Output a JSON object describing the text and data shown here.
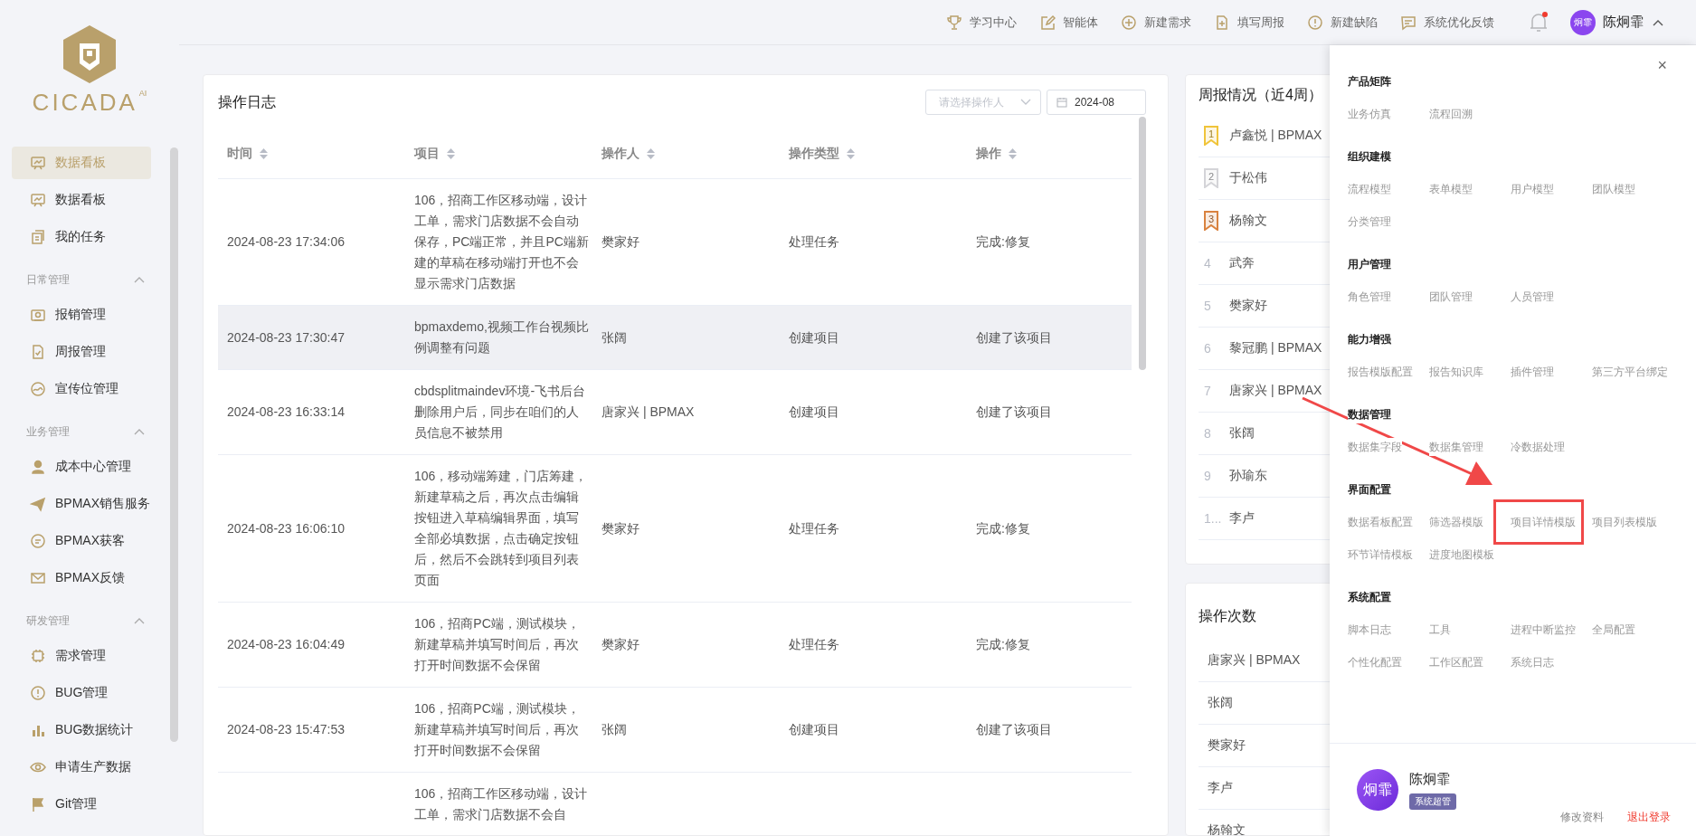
{
  "sidebar": {
    "logo": {
      "text": "CICADA",
      "badge": "AI"
    },
    "top_items": [
      {
        "label": "数据看板",
        "selected": true
      },
      {
        "label": "数据看板",
        "selected": false
      },
      {
        "label": "我的任务",
        "selected": false
      }
    ],
    "groups": [
      {
        "title": "日常管理",
        "expanded": true,
        "items": [
          {
            "label": "报销管理",
            "selected": false
          },
          {
            "label": "周报管理",
            "selected": false
          },
          {
            "label": "宣传位管理",
            "selected": false
          }
        ]
      },
      {
        "title": "业务管理",
        "expanded": true,
        "items": [
          {
            "label": "成本中心管理",
            "selected": false
          },
          {
            "label": "BPMAX销售服务",
            "selected": false
          },
          {
            "label": "BPMAX获客",
            "selected": false
          },
          {
            "label": "BPMAX反馈",
            "selected": false
          }
        ]
      },
      {
        "title": "研发管理",
        "expanded": true,
        "items": [
          {
            "label": "需求管理",
            "selected": false
          },
          {
            "label": "BUG管理",
            "selected": false
          },
          {
            "label": "BUG数据统计",
            "selected": false
          },
          {
            "label": "申请生产数据",
            "selected": false
          },
          {
            "label": "Git管理",
            "selected": false
          }
        ]
      }
    ]
  },
  "topbar": {
    "actions": [
      "学习中心",
      "智能体",
      "新建需求",
      "填写周报",
      "新建缺陷",
      "系统优化反馈"
    ],
    "notifications": {
      "unread": true
    },
    "user": {
      "avatar": "炯霏",
      "name": "陈炯霏",
      "menu_open": true
    }
  },
  "log_card": {
    "title": "操作日志",
    "operator_select": {
      "placeholder": "请选择操作人"
    },
    "month_picker": {
      "value": "2024-08"
    },
    "table": {
      "columns": [
        "时间",
        "项目",
        "操作人",
        "操作类型",
        "操作"
      ],
      "rows": [
        {
          "cells": [
            "2024-08-23 17:34:06",
            "106，招商工作区移动端，设计工单，需求门店数据不会自动保存，PC端正常，并且PC端新建的草稿在移动端打开也不会显示需求门店数据",
            "樊家好",
            "处理任务",
            "完成:修复"
          ],
          "hovered": false
        },
        {
          "cells": [
            "2024-08-23 17:30:47",
            "bpmaxdemo,视频工作台视频比例调整有问题",
            "张阔",
            "创建项目",
            "创建了该项目"
          ],
          "hovered": true
        },
        {
          "cells": [
            "2024-08-23 16:33:14",
            "cbdsplitmaindev环境-飞书后台删除用户后，同步在咱们的人员信息不被禁用",
            "唐家兴 | BPMAX",
            "创建项目",
            "创建了该项目"
          ],
          "hovered": false
        },
        {
          "cells": [
            "2024-08-23 16:06:10",
            "106，移动端筹建，门店筹建，新建草稿之后，再次点击编辑按钮进入草稿编辑界面，填写全部必填数据，点击确定按钮后，然后不会跳转到项目列表页面",
            "樊家好",
            "处理任务",
            "完成:修复"
          ],
          "hovered": false
        },
        {
          "cells": [
            "2024-08-23 16:04:49",
            "106，招商PC端，测试模块，新建草稿并填写时间后，再次打开时间数据不会保留",
            "樊家好",
            "处理任务",
            "完成:修复"
          ],
          "hovered": false
        },
        {
          "cells": [
            "2024-08-23 15:47:53",
            "106，招商PC端，测试模块，新建草稿并填写时间后，再次打开时间数据不会保留",
            "张阔",
            "创建项目",
            "创建了该项目"
          ],
          "hovered": false
        },
        {
          "cells": [
            "",
            "106，招商工作区移动端，设计工单，需求门店数据不会自",
            "",
            "",
            ""
          ],
          "hovered": false
        }
      ]
    }
  },
  "weekly_card": {
    "title": "周报情况（近4周）",
    "rows": [
      {
        "kind": "medal",
        "rank": "1",
        "color": "#f0c43a",
        "name": "卢鑫悦 | BPMAX"
      },
      {
        "kind": "medal",
        "rank": "2",
        "color": "#d4d4d8",
        "name": "于松伟"
      },
      {
        "kind": "medal",
        "rank": "3",
        "color": "#d9823f",
        "name": "杨翰文"
      },
      {
        "kind": "number",
        "rank": "4",
        "name": "武奔"
      },
      {
        "kind": "number",
        "rank": "5",
        "name": "樊家好"
      },
      {
        "kind": "number",
        "rank": "6",
        "name": "黎冠鹏 | BPMAX"
      },
      {
        "kind": "number",
        "rank": "7",
        "name": "唐家兴 | BPMAX"
      },
      {
        "kind": "number",
        "rank": "8",
        "name": "张阔"
      },
      {
        "kind": "number",
        "rank": "9",
        "name": "孙瑜东"
      },
      {
        "kind": "number",
        "rank": "1...",
        "name": "李卢"
      }
    ]
  },
  "ops_card": {
    "title": "操作次数",
    "rows": [
      "唐家兴 | BPMAX",
      "张阔",
      "樊家好",
      "李卢",
      "杨翰文"
    ]
  },
  "menu_panel": {
    "close": "×",
    "sections": [
      {
        "title": "产品矩阵",
        "items": [
          {
            "label": "业务仿真",
            "annotated": false
          },
          {
            "label": "流程回溯",
            "annotated": false
          }
        ]
      },
      {
        "title": "组织建模",
        "items": [
          {
            "label": "流程模型",
            "annotated": false
          },
          {
            "label": "表单模型",
            "annotated": false
          },
          {
            "label": "用户模型",
            "annotated": false
          },
          {
            "label": "团队模型",
            "annotated": false
          },
          {
            "label": "分类管理",
            "annotated": false
          }
        ]
      },
      {
        "title": "用户管理",
        "items": [
          {
            "label": "角色管理",
            "annotated": false
          },
          {
            "label": "团队管理",
            "annotated": false
          },
          {
            "label": "人员管理",
            "annotated": false
          }
        ]
      },
      {
        "title": "能力增强",
        "items": [
          {
            "label": "报告模版配置",
            "annotated": false
          },
          {
            "label": "报告知识库",
            "annotated": false
          },
          {
            "label": "插件管理",
            "annotated": false
          },
          {
            "label": "第三方平台绑定",
            "annotated": false
          }
        ]
      },
      {
        "title": "数据管理",
        "items": [
          {
            "label": "数据集字段",
            "annotated": false
          },
          {
            "label": "数据集管理",
            "annotated": false
          },
          {
            "label": "冷数据处理",
            "annotated": false
          }
        ]
      },
      {
        "title": "界面配置",
        "items": [
          {
            "label": "数据看板配置",
            "annotated": false
          },
          {
            "label": "筛选器模版",
            "annotated": false
          },
          {
            "label": "项目详情模版",
            "annotated": true
          },
          {
            "label": "项目列表模版",
            "annotated": false
          },
          {
            "label": "环节详情模板",
            "annotated": false
          },
          {
            "label": "进度地图模板",
            "annotated": false
          }
        ]
      },
      {
        "title": "系统配置",
        "items": [
          {
            "label": "脚本日志",
            "annotated": false
          },
          {
            "label": "工具",
            "annotated": false
          },
          {
            "label": "进程中断监控",
            "annotated": false
          },
          {
            "label": "全局配置",
            "annotated": false
          },
          {
            "label": "个性化配置",
            "annotated": false
          },
          {
            "label": "工作区配置",
            "annotated": false
          },
          {
            "label": "系统日志",
            "annotated": false
          }
        ]
      }
    ],
    "profile": {
      "avatar": "炯霏",
      "name": "陈炯霏",
      "role": "系统超管",
      "links": [
        {
          "label": "修改资料",
          "kind": "normal"
        },
        {
          "label": "退出登录",
          "kind": "danger"
        }
      ]
    }
  }
}
